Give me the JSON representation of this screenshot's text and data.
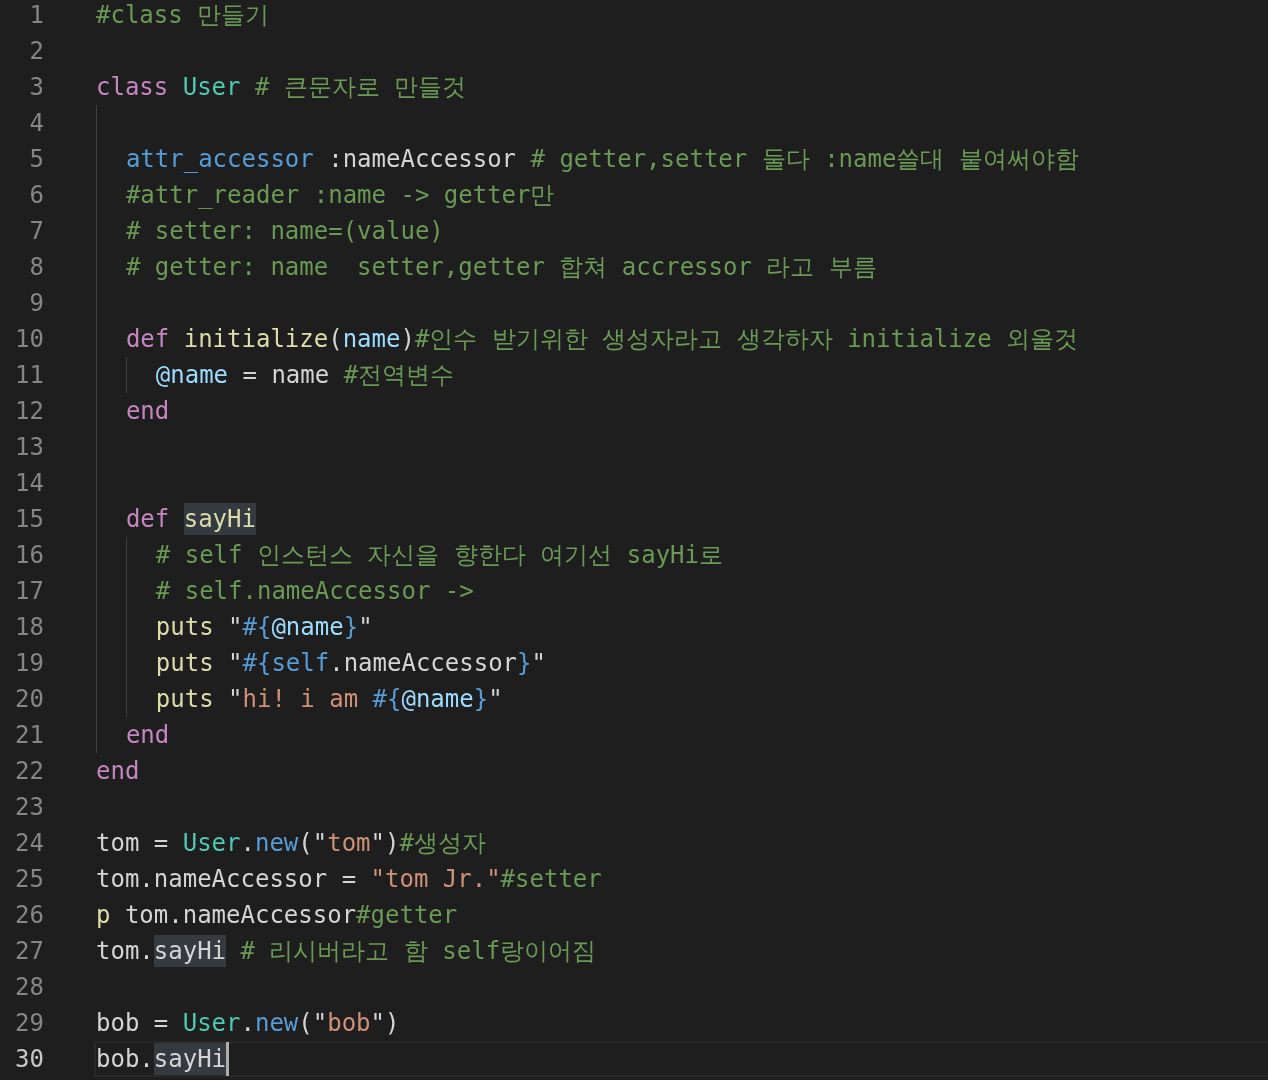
{
  "editor": {
    "lines": [
      {
        "number": "1",
        "current": false,
        "tokens": [
          {
            "kind": "comment",
            "text": "#class 만들기",
            "highlighted": false
          }
        ]
      },
      {
        "number": "2",
        "current": false
      },
      {
        "number": "3",
        "current": false,
        "tokens": [
          {
            "kind": "keyword",
            "text": "class ",
            "highlighted": false
          },
          {
            "kind": "type",
            "text": "User",
            "highlighted": false
          },
          {
            "kind": "comment",
            "text": " # 큰문자로 만들것",
            "highlighted": false
          }
        ],
        "children": [
          {
            "number": "4",
            "current": false
          },
          {
            "number": "5",
            "current": false,
            "tokens": [
              {
                "kind": "builtin",
                "text": "attr_accessor",
                "highlighted": false
              },
              {
                "kind": "plain",
                "text": " :nameAccessor",
                "highlighted": false
              },
              {
                "kind": "comment",
                "text": " # getter,setter 둘다 :name쓸대 붙여써야함",
                "highlighted": false
              }
            ]
          },
          {
            "number": "6",
            "current": false,
            "tokens": [
              {
                "kind": "comment",
                "text": "#attr_reader :name -> getter만",
                "highlighted": false
              }
            ]
          },
          {
            "number": "7",
            "current": false,
            "tokens": [
              {
                "kind": "comment",
                "text": "# setter: name=(value)",
                "highlighted": false
              }
            ]
          },
          {
            "number": "8",
            "current": false,
            "tokens": [
              {
                "kind": "comment",
                "text": "# getter: name  setter,getter 합쳐 accressor 라고 부름",
                "highlighted": false
              }
            ]
          },
          {
            "number": "9",
            "current": false
          },
          {
            "number": "10",
            "current": false,
            "tokens": [
              {
                "kind": "keyword",
                "text": "def ",
                "highlighted": false
              },
              {
                "kind": "function",
                "text": "initialize",
                "highlighted": false
              },
              {
                "kind": "plain",
                "text": "(",
                "highlighted": false
              },
              {
                "kind": "variable",
                "text": "name",
                "highlighted": false
              },
              {
                "kind": "plain",
                "text": ")",
                "highlighted": false
              },
              {
                "kind": "comment",
                "text": "#인수 받기위한 생성자라고 생각하자 initialize 외울것",
                "highlighted": false
              }
            ],
            "children": [
              {
                "number": "11",
                "current": false,
                "tokens": [
                  {
                    "kind": "variable",
                    "text": "@name",
                    "highlighted": false
                  },
                  {
                    "kind": "plain",
                    "text": " = name ",
                    "highlighted": false
                  },
                  {
                    "kind": "comment",
                    "text": "#전역변수",
                    "highlighted": false
                  }
                ]
              }
            ]
          },
          {
            "number": "12",
            "current": false,
            "tokens": [
              {
                "kind": "keyword",
                "text": "end",
                "highlighted": false
              }
            ]
          },
          {
            "number": "13",
            "current": false
          },
          {
            "number": "14",
            "current": false
          },
          {
            "number": "15",
            "current": false,
            "tokens": [
              {
                "kind": "keyword",
                "text": "def ",
                "highlighted": false
              },
              {
                "kind": "function",
                "text": "sayHi",
                "highlighted": true
              }
            ],
            "children": [
              {
                "number": "16",
                "current": false,
                "tokens": [
                  {
                    "kind": "comment",
                    "text": "# self 인스턴스 자신을 향한다 여기선 sayHi로",
                    "highlighted": false
                  }
                ]
              },
              {
                "number": "17",
                "current": false,
                "tokens": [
                  {
                    "kind": "comment",
                    "text": "# self.nameAccessor ->",
                    "highlighted": false
                  }
                ]
              },
              {
                "number": "18",
                "current": false,
                "tokens": [
                  {
                    "kind": "function",
                    "text": "puts",
                    "highlighted": false
                  },
                  {
                    "kind": "plain",
                    "text": " \"",
                    "highlighted": false
                  },
                  {
                    "kind": "builtin",
                    "text": "#{",
                    "highlighted": false
                  },
                  {
                    "kind": "variable",
                    "text": "@name",
                    "highlighted": false
                  },
                  {
                    "kind": "builtin",
                    "text": "}",
                    "highlighted": false
                  },
                  {
                    "kind": "plain",
                    "text": "\"",
                    "highlighted": false
                  }
                ]
              },
              {
                "number": "19",
                "current": false,
                "tokens": [
                  {
                    "kind": "function",
                    "text": "puts",
                    "highlighted": false
                  },
                  {
                    "kind": "plain",
                    "text": " \"",
                    "highlighted": false
                  },
                  {
                    "kind": "builtin",
                    "text": "#{self",
                    "highlighted": false
                  },
                  {
                    "kind": "plain",
                    "text": ".nameAccessor",
                    "highlighted": false
                  },
                  {
                    "kind": "builtin",
                    "text": "}",
                    "highlighted": false
                  },
                  {
                    "kind": "plain",
                    "text": "\"",
                    "highlighted": false
                  }
                ]
              },
              {
                "number": "20",
                "current": false,
                "tokens": [
                  {
                    "kind": "function",
                    "text": "puts",
                    "highlighted": false
                  },
                  {
                    "kind": "plain",
                    "text": " \"",
                    "highlighted": false
                  },
                  {
                    "kind": "string",
                    "text": "hi! i am ",
                    "highlighted": false
                  },
                  {
                    "kind": "builtin",
                    "text": "#{",
                    "highlighted": false
                  },
                  {
                    "kind": "variable",
                    "text": "@name",
                    "highlighted": false
                  },
                  {
                    "kind": "builtin",
                    "text": "}",
                    "highlighted": false
                  },
                  {
                    "kind": "plain",
                    "text": "\"",
                    "highlighted": false
                  }
                ]
              }
            ]
          },
          {
            "number": "21",
            "current": false,
            "tokens": [
              {
                "kind": "keyword",
                "text": "end",
                "highlighted": false
              }
            ]
          }
        ]
      },
      {
        "number": "22",
        "current": false,
        "tokens": [
          {
            "kind": "keyword",
            "text": "end",
            "highlighted": false
          }
        ]
      },
      {
        "number": "23",
        "current": false
      },
      {
        "number": "24",
        "current": false,
        "tokens": [
          {
            "kind": "plain",
            "text": "tom = ",
            "highlighted": false
          },
          {
            "kind": "type",
            "text": "User",
            "highlighted": false
          },
          {
            "kind": "plain",
            "text": ".",
            "highlighted": false
          },
          {
            "kind": "builtin",
            "text": "new",
            "highlighted": false
          },
          {
            "kind": "plain",
            "text": "(\"",
            "highlighted": false
          },
          {
            "kind": "string",
            "text": "tom",
            "highlighted": false
          },
          {
            "kind": "plain",
            "text": "\")",
            "highlighted": false
          },
          {
            "kind": "comment",
            "text": "#생성자",
            "highlighted": false
          }
        ]
      },
      {
        "number": "25",
        "current": false,
        "tokens": [
          {
            "kind": "plain",
            "text": "tom.nameAccessor = ",
            "highlighted": false
          },
          {
            "kind": "string",
            "text": "\"tom Jr.\"",
            "highlighted": false
          },
          {
            "kind": "comment",
            "text": "#setter",
            "highlighted": false
          }
        ]
      },
      {
        "number": "26",
        "current": false,
        "tokens": [
          {
            "kind": "function",
            "text": "p",
            "highlighted": false
          },
          {
            "kind": "plain",
            "text": " tom.nameAccessor",
            "highlighted": false
          },
          {
            "kind": "comment",
            "text": "#getter",
            "highlighted": false
          }
        ]
      },
      {
        "number": "27",
        "current": false,
        "tokens": [
          {
            "kind": "plain",
            "text": "tom.",
            "highlighted": false
          },
          {
            "kind": "plain",
            "text": "sayHi",
            "highlighted": true
          },
          {
            "kind": "comment",
            "text": " # 리시버라고 함 self랑이어짐",
            "highlighted": false
          }
        ]
      },
      {
        "number": "28",
        "current": false
      },
      {
        "number": "29",
        "current": false,
        "tokens": [
          {
            "kind": "plain",
            "text": "bob = ",
            "highlighted": false
          },
          {
            "kind": "type",
            "text": "User",
            "highlighted": false
          },
          {
            "kind": "plain",
            "text": ".",
            "highlighted": false
          },
          {
            "kind": "builtin",
            "text": "new",
            "highlighted": false
          },
          {
            "kind": "plain",
            "text": "(\"",
            "highlighted": false
          },
          {
            "kind": "string",
            "text": "bob",
            "highlighted": false
          },
          {
            "kind": "plain",
            "text": "\")",
            "highlighted": false
          }
        ]
      },
      {
        "number": "30",
        "current": true,
        "tokens": [
          {
            "kind": "plain",
            "text": "bob.",
            "highlighted": false
          },
          {
            "kind": "plain",
            "text": "sayHi",
            "highlighted": true
          }
        ]
      }
    ]
  }
}
